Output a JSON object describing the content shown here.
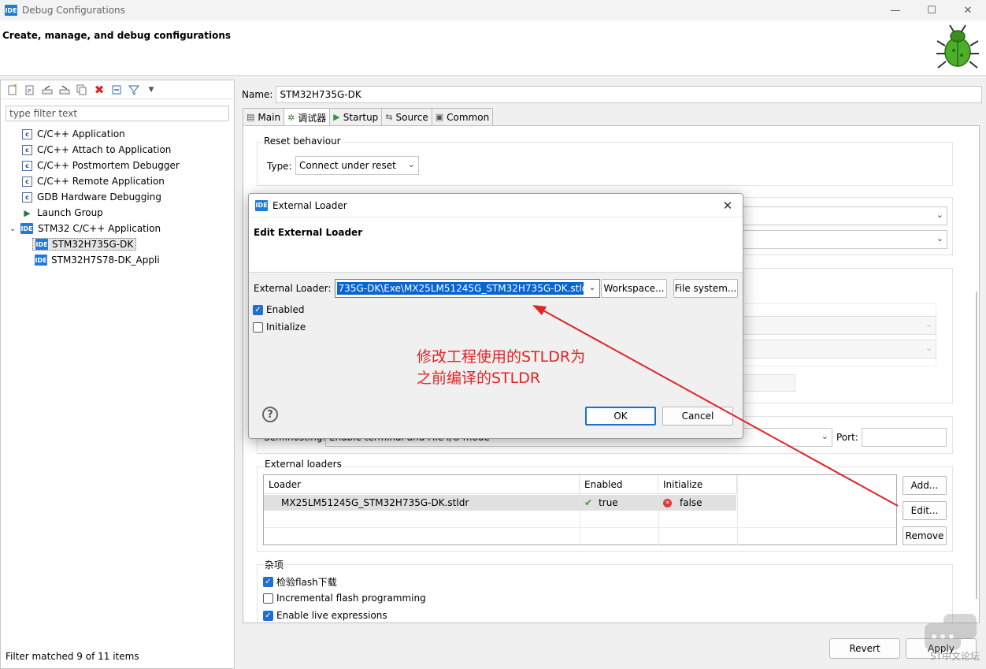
{
  "window": {
    "title": "Debug Configurations",
    "app_badge": "IDE",
    "minimize": "—",
    "maximize": "☐",
    "close": "✕"
  },
  "banner": {
    "heading": "Create, manage, and debug configurations"
  },
  "left": {
    "filter_placeholder": "type filter text",
    "tree": [
      {
        "label": "C/C++ Application",
        "icon": "c-icon"
      },
      {
        "label": "C/C++ Attach to Application",
        "icon": "c-icon"
      },
      {
        "label": "C/C++ Postmortem Debugger",
        "icon": "c-icon"
      },
      {
        "label": "C/C++ Remote Application",
        "icon": "c-icon"
      },
      {
        "label": "GDB Hardware Debugging",
        "icon": "c-icon"
      },
      {
        "label": "Launch Group",
        "icon": "launch-group-icon"
      },
      {
        "label": "STM32 C/C++ Application",
        "icon": "ide-icon"
      },
      {
        "label": "STM32H735G-DK",
        "icon": "ide-icon"
      },
      {
        "label": "STM32H7S78-DK_Appli",
        "icon": "ide-icon"
      }
    ],
    "status": "Filter matched 9 of 11 items"
  },
  "right": {
    "name_label": "Name:",
    "name_value": "STM32H735G-DK",
    "tabs": [
      {
        "label": "Main",
        "icon": "main-tab-icon"
      },
      {
        "label": "调试器",
        "icon": "debugger-tab-icon"
      },
      {
        "label": "Startup",
        "icon": "startup-tab-icon"
      },
      {
        "label": "Source",
        "icon": "source-tab-icon"
      },
      {
        "label": "Common",
        "icon": "common-tab-icon"
      }
    ],
    "reset_behaviour": {
      "title": "Reset behaviour",
      "type_label": "Type:",
      "type_value": "Connect under reset"
    },
    "semihosting": {
      "label": "Semihosting:",
      "value": "Enable terminal and File I/O mode",
      "port_label": "Port:"
    },
    "external_loaders": {
      "title": "External loaders",
      "columns": [
        "Loader",
        "Enabled",
        "Initialize"
      ],
      "rows": [
        {
          "loader": "MX25LM51245G_STM32H735G-DK.stldr",
          "enabled": "true",
          "initialize": "false"
        }
      ],
      "add": "Add...",
      "edit": "Edit...",
      "remove": "Remove"
    },
    "misc": {
      "title": "杂项",
      "verify_flash": "检验flash下载",
      "incremental_flash": "Incremental flash programming",
      "live_expressions": "Enable live expressions"
    },
    "revert": "Revert",
    "apply": "Apply"
  },
  "dialog": {
    "title": "External Loader",
    "heading": "Edit External Loader",
    "loader_label": "External Loader:",
    "loader_value": "735G-DK\\Exe\\MX25LM51245G_STM32H735G-DK.stldr",
    "workspace": "Workspace...",
    "file_system": "File system...",
    "enabled_label": "Enabled",
    "initialize_label": "Initialize",
    "ok": "OK",
    "cancel": "Cancel",
    "help": "?"
  },
  "annotation": {
    "line1": "修改工程使用的STLDR为",
    "line2": "之前编译的STLDR",
    "color": "#e02424"
  },
  "watermark": {
    "text": "ST中文论坛"
  }
}
